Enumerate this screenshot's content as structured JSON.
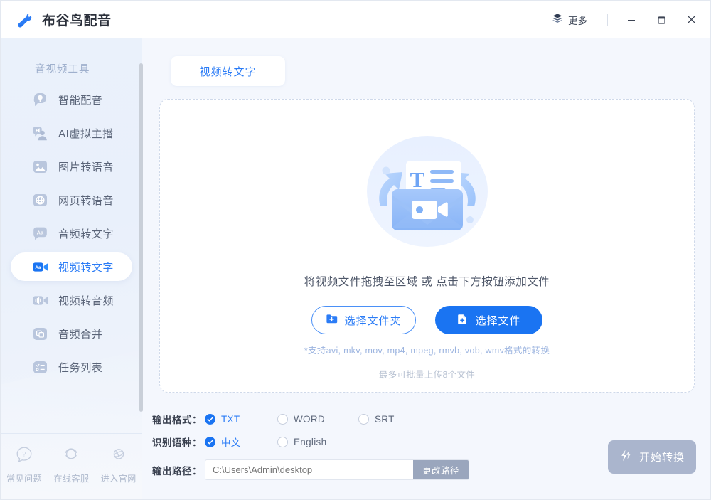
{
  "window": {
    "app_title": "布谷鸟配音",
    "logo_icon": "cuckoo-bird-logo",
    "more_label": "更多",
    "more_icon": "layers-icon",
    "minimize_icon": "minimize-icon",
    "maximize_icon": "maximize-icon",
    "close_icon": "close-icon"
  },
  "sidebar": {
    "group_title": "音视频工具",
    "items": [
      {
        "label": "智能配音",
        "icon": "mic-bubble-icon",
        "active": false
      },
      {
        "label": "AI虚拟主播",
        "icon": "speaker-person-icon",
        "active": false
      },
      {
        "label": "图片转语音",
        "icon": "image-icon",
        "active": false
      },
      {
        "label": "网页转语音",
        "icon": "globe-icon",
        "active": false
      },
      {
        "label": "音频转文字",
        "icon": "aa-bubble-icon",
        "active": false
      },
      {
        "label": "视频转文字",
        "icon": "aa-video-icon",
        "active": true
      },
      {
        "label": "视频转音频",
        "icon": "wave-video-icon",
        "active": false
      },
      {
        "label": "音频合并",
        "icon": "merge-icon",
        "active": false
      },
      {
        "label": "任务列表",
        "icon": "task-list-icon",
        "active": false
      }
    ],
    "footer": [
      {
        "label": "常见问题",
        "icon": "question-bubble-icon"
      },
      {
        "label": "在线客服",
        "icon": "headset-icon"
      },
      {
        "label": "进入官网",
        "icon": "globe-planet-icon"
      }
    ]
  },
  "main": {
    "tabs": [
      {
        "label": "视频转文字",
        "active": true
      }
    ],
    "dropzone": {
      "illustration_icon": "video-to-text-illustration",
      "hint": "将视频文件拖拽至区域 或 点击下方按钮添加文件",
      "choose_folder_label": "选择文件夹",
      "choose_folder_icon": "folder-plus-icon",
      "choose_file_label": "选择文件",
      "choose_file_icon": "file-plus-icon",
      "formats_note": "*支持avi, mkv, mov, mp4, mpeg, rmvb, vob, wmv格式的转换",
      "limit_note": "最多可批量上传8个文件"
    },
    "options": {
      "format_label": "输出格式：",
      "formats": [
        {
          "label": "TXT",
          "checked": true
        },
        {
          "label": "WORD",
          "checked": false
        },
        {
          "label": "SRT",
          "checked": false
        }
      ],
      "language_label": "识别语种：",
      "languages": [
        {
          "label": "中文",
          "checked": true
        },
        {
          "label": "English",
          "checked": false
        }
      ],
      "path_label": "输出路径：",
      "path_placeholder": "C:\\Users\\Admin\\desktop",
      "path_value": "",
      "change_path_label": "更改路径"
    },
    "start_button": {
      "label": "开始转换",
      "icon": "lightning-icon",
      "disabled": true
    }
  },
  "colors": {
    "accent": "#1a74f2",
    "accent_text": "#2b7cf6",
    "sidebar_bg": "#eaf1fb",
    "content_bg": "#f4f7fd",
    "disabled": "#aab5cd"
  }
}
